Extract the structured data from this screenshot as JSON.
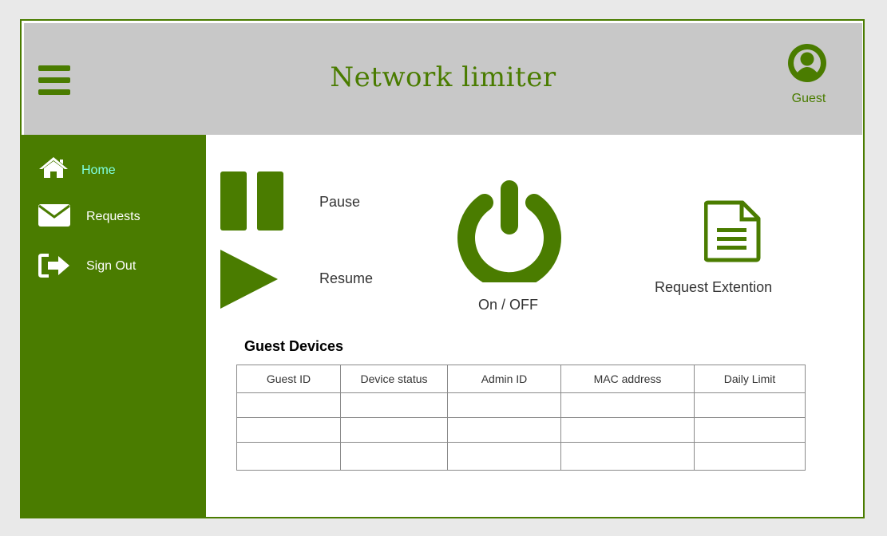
{
  "header": {
    "title": "Network limiter",
    "user_label": "Guest",
    "menu_icon": "hamburger-menu-icon",
    "user_icon": "user-avatar-icon"
  },
  "sidebar": {
    "items": [
      {
        "label": "Home",
        "icon": "home-icon",
        "active": true
      },
      {
        "label": "Requests",
        "icon": "envelope-icon",
        "active": false
      },
      {
        "label": "Sign Out",
        "icon": "sign-out-icon",
        "active": false
      }
    ]
  },
  "controls": {
    "pause_label": "Pause",
    "resume_label": "Resume",
    "power_label": "On / OFF",
    "request_label": "Request Extention"
  },
  "devices": {
    "title": "Guest Devices",
    "columns": [
      "Guest ID",
      "Device status",
      "Admin ID",
      "MAC address",
      "Daily Limit"
    ],
    "rows": [
      [
        "",
        "",
        "",
        "",
        ""
      ],
      [
        "",
        "",
        "",
        "",
        ""
      ],
      [
        "",
        "",
        "",
        "",
        ""
      ]
    ]
  },
  "colors": {
    "accent": "#4a7c00",
    "header_bg": "#c8c8c8",
    "active_nav_text": "#7fffe0"
  }
}
